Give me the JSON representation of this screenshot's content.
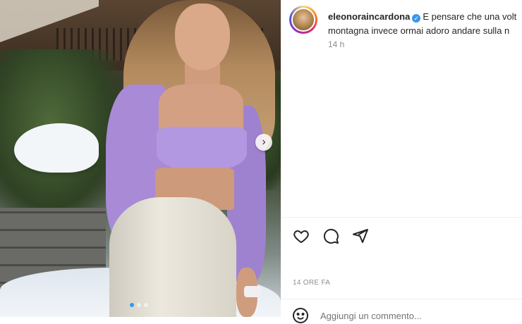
{
  "post": {
    "username": "eleonoraincardona",
    "caption": "E pensare che una volta ... montagna invece ormai adoro andare sulla n",
    "caption_line1": "E pensare che una volt",
    "caption_line2": "montagna invece ormai adoro andare sulla n",
    "time_short": "14 h",
    "time_caps": "14 ORE FA"
  },
  "comment": {
    "placeholder": "Aggiungi un commento..."
  },
  "carousel": {
    "slides": 3,
    "active_index": 0
  },
  "colors": {
    "verified": "#3897f0",
    "text": "#262626",
    "muted": "#8e8e8e"
  },
  "icons": [
    "heart-icon",
    "comment-icon",
    "share-icon",
    "chevron-right-icon",
    "verified-badge-icon",
    "emoji-icon"
  ]
}
